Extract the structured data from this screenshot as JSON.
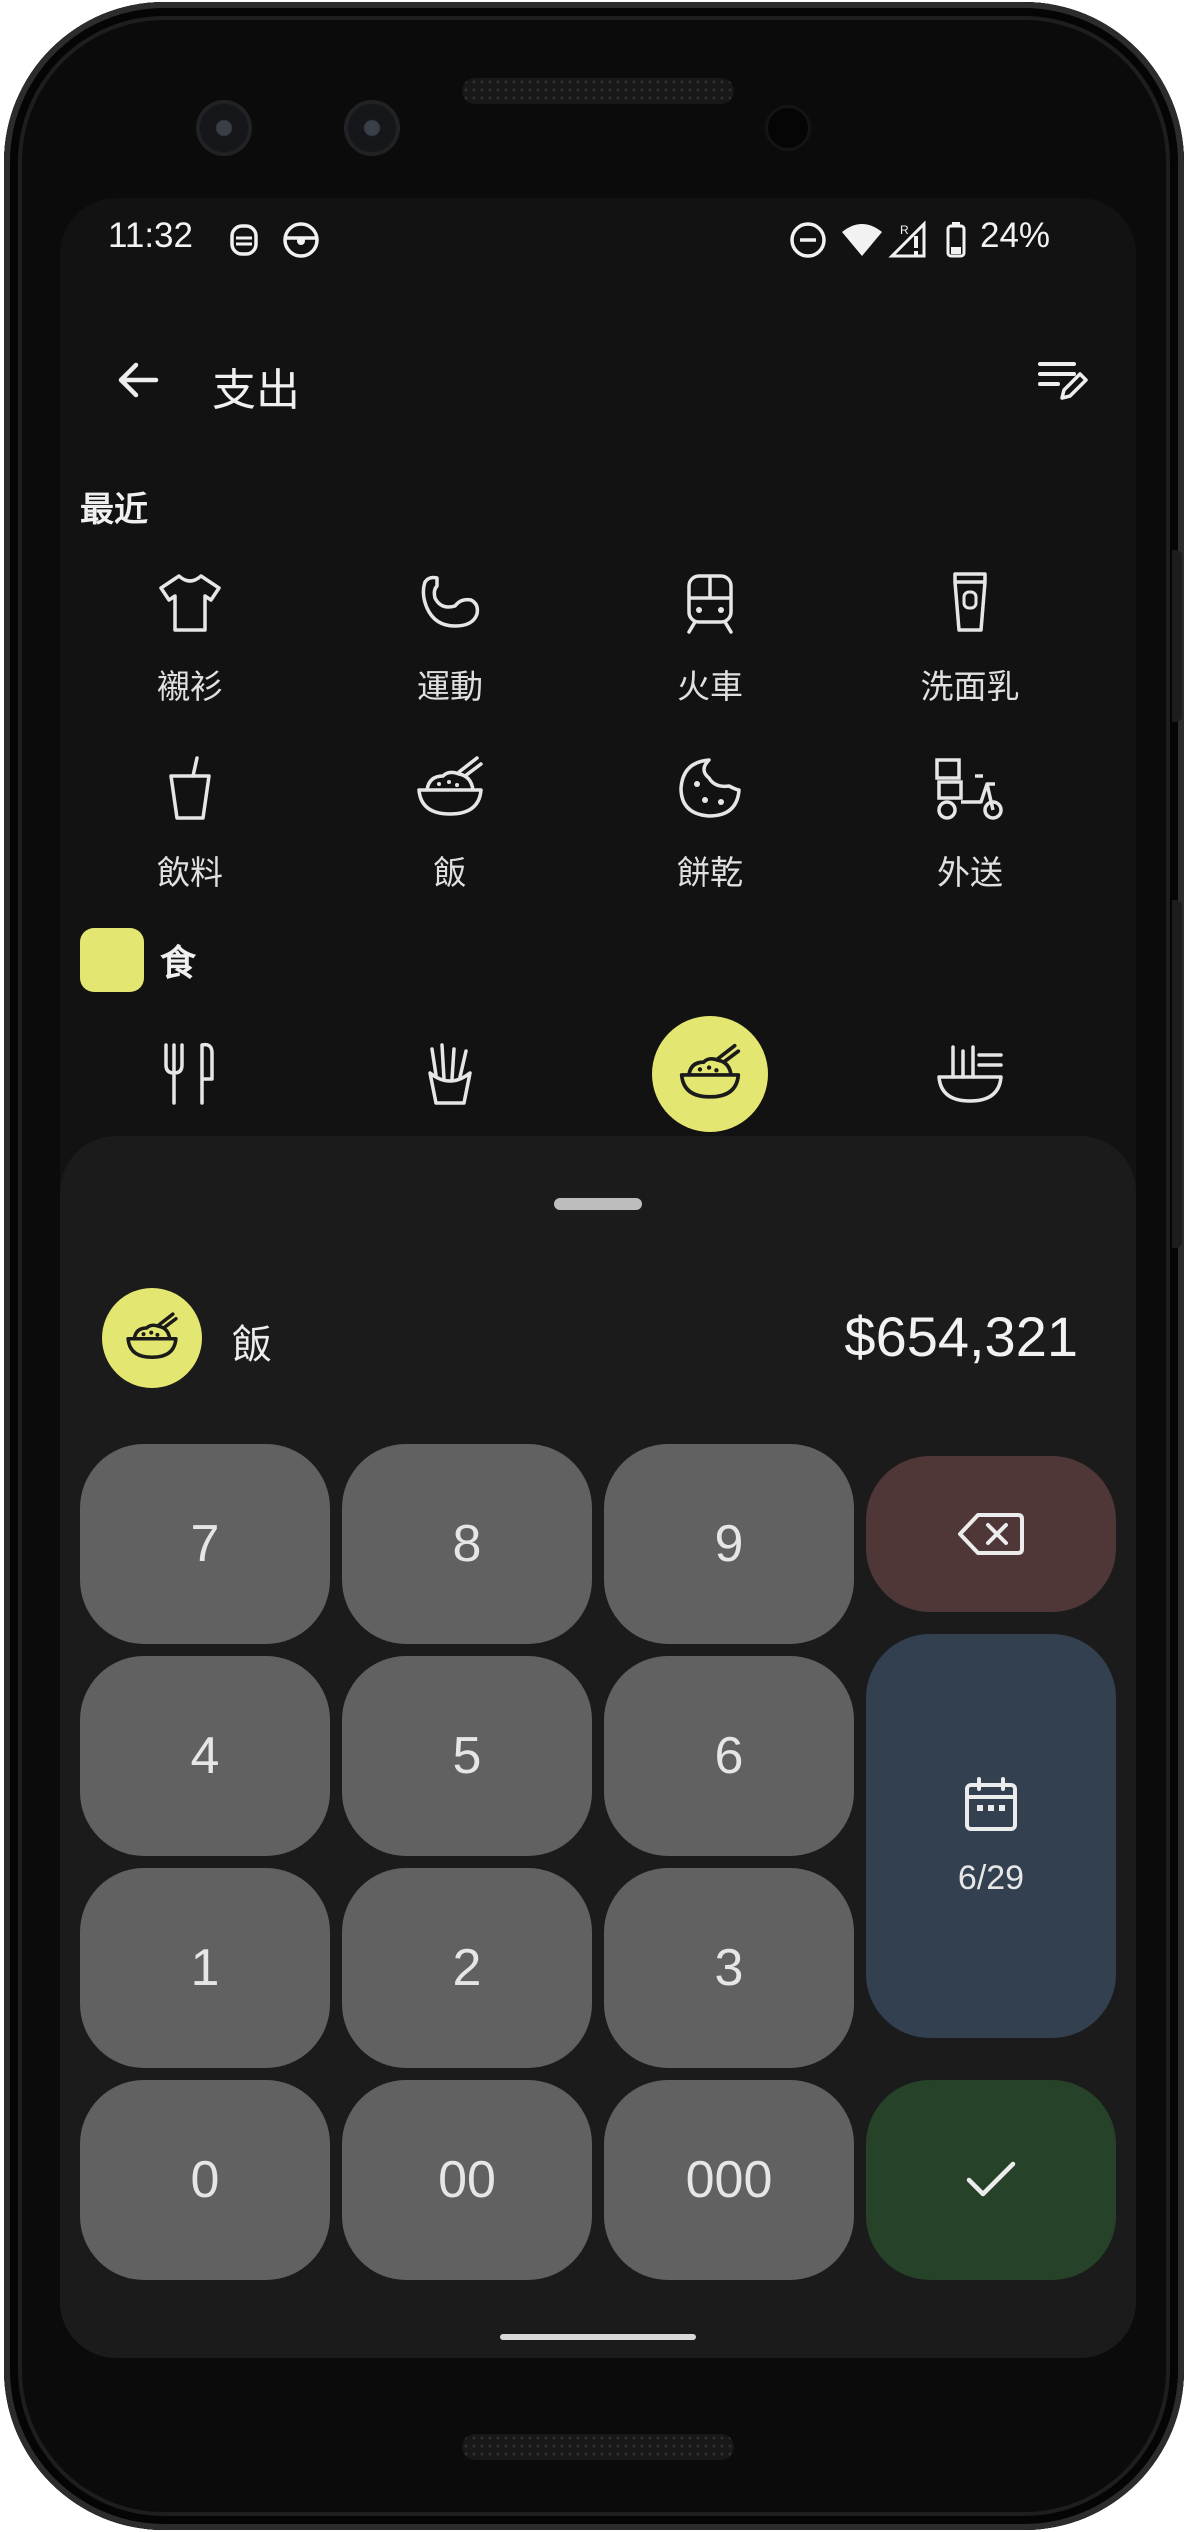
{
  "status_bar": {
    "time": "11:32",
    "battery": "24%"
  },
  "app_bar": {
    "title": "支出",
    "back_icon": "arrow-left-icon",
    "edit_icon": "edit-list-icon"
  },
  "recent": {
    "label": "最近",
    "items": [
      {
        "label": "襯衫",
        "icon": "shirt-icon"
      },
      {
        "label": "運動",
        "icon": "arm-muscle-icon"
      },
      {
        "label": "火車",
        "icon": "train-icon"
      },
      {
        "label": "洗面乳",
        "icon": "cleanser-tube-icon"
      },
      {
        "label": "飲料",
        "icon": "drink-cup-icon"
      },
      {
        "label": "飯",
        "icon": "rice-bowl-icon"
      },
      {
        "label": "餅乾",
        "icon": "cookie-icon"
      },
      {
        "label": "外送",
        "icon": "delivery-scooter-icon"
      }
    ]
  },
  "category": {
    "label": "食",
    "color": "#e4e672",
    "items": [
      {
        "icon": "fork-knife-icon",
        "selected": false
      },
      {
        "icon": "fries-icon",
        "selected": false
      },
      {
        "icon": "rice-bowl-icon",
        "selected": true
      },
      {
        "icon": "noodle-bowl-icon",
        "selected": false
      }
    ]
  },
  "entry": {
    "item_name": "飯",
    "item_icon": "rice-bowl-icon",
    "amount": "$654,321"
  },
  "keypad": {
    "keys": [
      "7",
      "8",
      "9",
      "4",
      "5",
      "6",
      "1",
      "2",
      "3",
      "0",
      "00",
      "000"
    ],
    "date": "6/29",
    "backspace_icon": "backspace-icon",
    "calendar_icon": "calendar-icon",
    "confirm_icon": "check-icon"
  },
  "colors": {
    "accent": "#e4e672",
    "background": "#121212",
    "sheet": "#1b1b1b",
    "key": "#616161",
    "delete_key": "#4f3738",
    "date_key": "#334050",
    "confirm_key": "#264228"
  }
}
